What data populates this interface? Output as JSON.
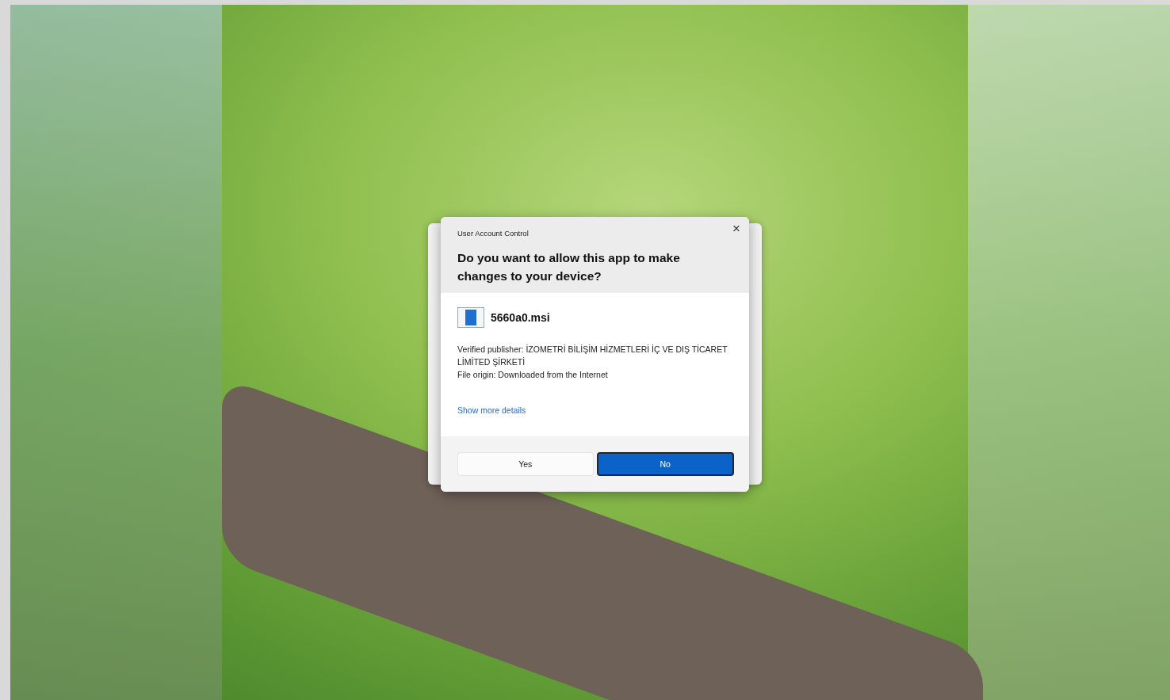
{
  "dialog": {
    "title": "User Account Control",
    "heading": "Do you want to allow this app to make changes to your device?",
    "file_name": "5660a0.msi",
    "publisher": "Verified publisher: İZOMETRİ BİLİŞİM HİZMETLERİ İÇ VE DIŞ TİCARET LİMİTED ŞİRKETİ",
    "origin": "File origin: Downloaded from the Internet",
    "details_link": "Show more details",
    "close": "×",
    "buttons": [
      {
        "label": "Yes",
        "default": false
      },
      {
        "label": "No",
        "default": true
      }
    ]
  }
}
